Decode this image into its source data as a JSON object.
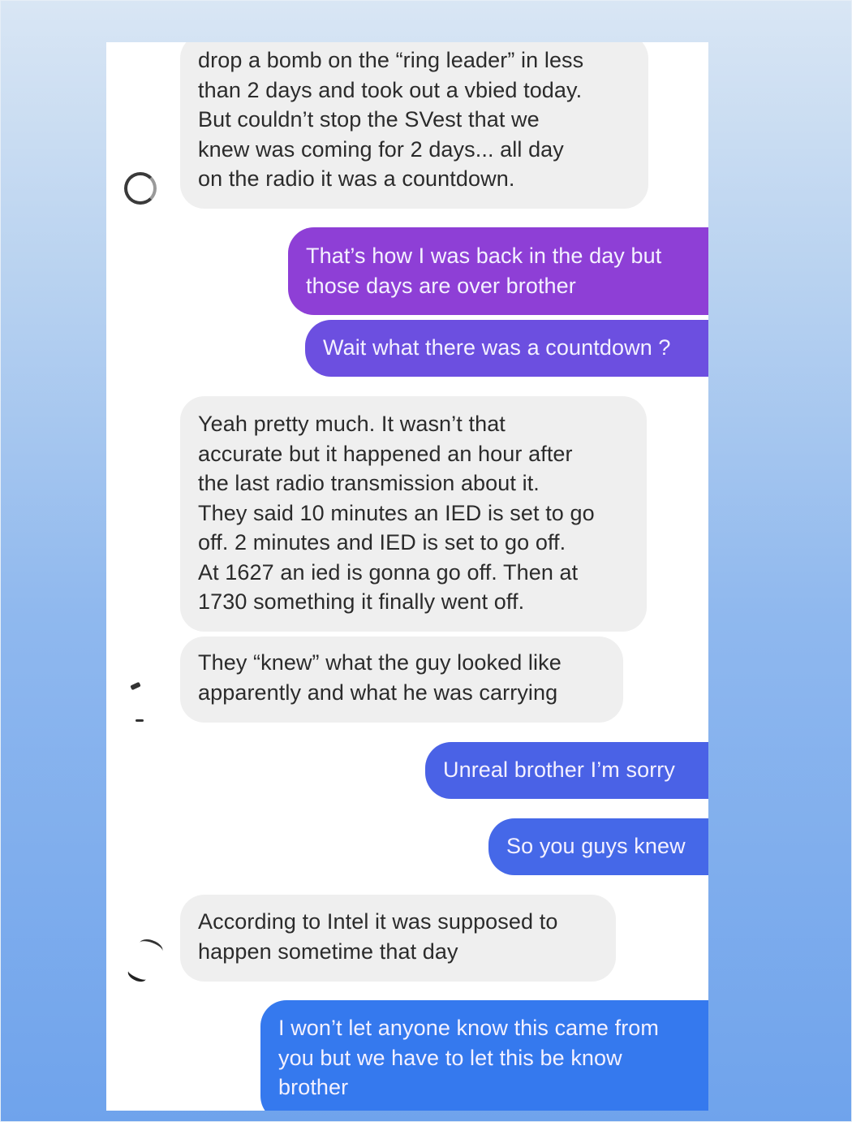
{
  "conversation": {
    "messages": [
      {
        "side": "received",
        "text": "drop a bomb on the “ring leader” in less\nthan 2 days and took out a vbied today.\nBut couldn’t stop the SVest that we\nknew was coming for 2 days... all day\non the radio it was a countdown."
      },
      {
        "side": "sent",
        "text": "That’s how I was back in the day but\nthose days are over brother"
      },
      {
        "side": "sent",
        "text": "Wait what there was a countdown ?"
      },
      {
        "side": "received",
        "text": "Yeah pretty much. It wasn’t that\naccurate but it happened an hour after\nthe last radio transmission about it.\nThey said 10 minutes an IED is set to go\noff. 2 minutes and IED is set to go off.\nAt 1627 an ied is gonna go off. Then at\n1730 something it finally went off."
      },
      {
        "side": "received",
        "text": "They “knew” what the guy looked like\napparently and what he was carrying"
      },
      {
        "side": "sent",
        "text": "Unreal brother I’m sorry"
      },
      {
        "side": "sent",
        "text": "So you guys knew"
      },
      {
        "side": "received",
        "text": "According to Intel it was supposed to\nhappen sometime that day"
      },
      {
        "side": "sent",
        "text": "I won’t let anyone know this came from\nyou but we have to let this be know\nbrother"
      }
    ]
  },
  "colors": {
    "received_bubble": "#efefef",
    "sent_purple": "#8e3fd6",
    "sent_violet": "#6c4fe0",
    "sent_indigo": "#4a62e6",
    "sent_blue": "#3579ee"
  }
}
